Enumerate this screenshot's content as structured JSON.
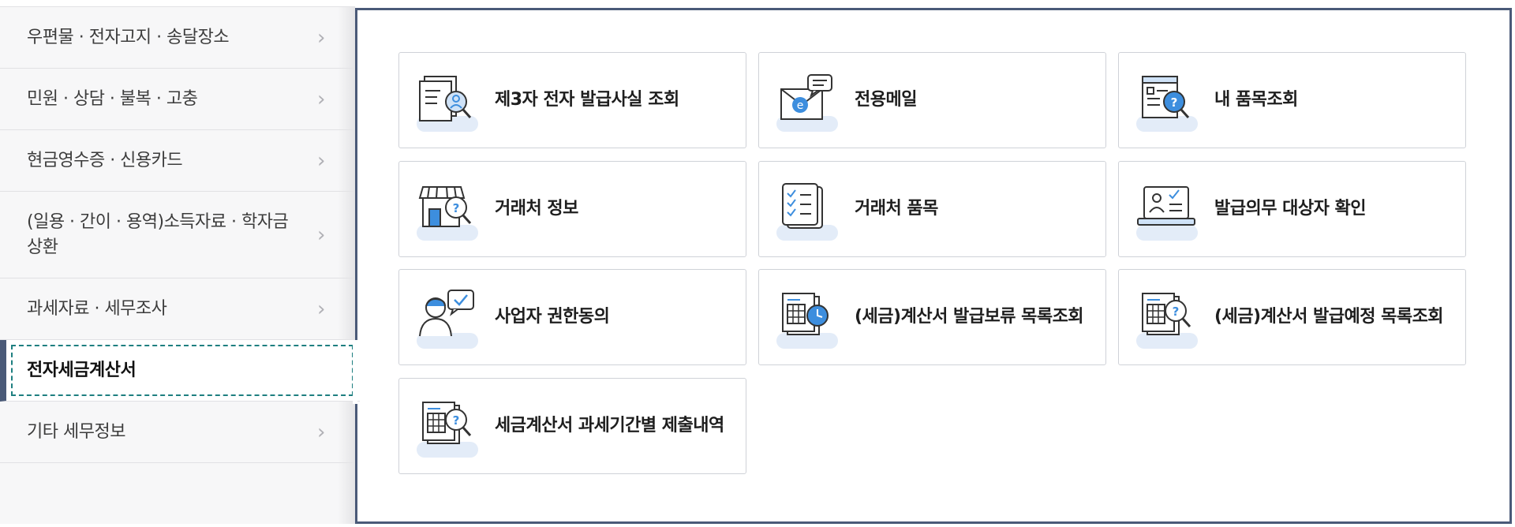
{
  "sidebar": {
    "items": [
      {
        "label": "우편물 · 전자고지 · 송달장소",
        "active": false
      },
      {
        "label": "민원 · 상담 · 불복 · 고충",
        "active": false
      },
      {
        "label": "현금영수증 · 신용카드",
        "active": false
      },
      {
        "label": "(일용 · 간이 · 용역)소득자료 · 학자금상환",
        "active": false
      },
      {
        "label": "과세자료 · 세무조사",
        "active": false
      },
      {
        "label": "전자세금계산서",
        "active": true
      },
      {
        "label": "기타 세무정보",
        "active": false
      }
    ],
    "chevron_icon": "chevron-right-icon"
  },
  "menu": {
    "cards": [
      {
        "label": "제3자 전자 발급사실 조회",
        "icon": "document-search-icon"
      },
      {
        "label": "전용메일",
        "icon": "email-icon"
      },
      {
        "label": "내 품목조회",
        "icon": "item-lookup-icon"
      },
      {
        "label": "거래처 정보",
        "icon": "store-search-icon"
      },
      {
        "label": "거래처 품목",
        "icon": "checklist-icon"
      },
      {
        "label": "발급의무 대상자 확인",
        "icon": "id-card-check-icon"
      },
      {
        "label": "사업자 권한동의",
        "icon": "user-consent-icon"
      },
      {
        "label": "(세금)계산서 발급보류 목록조회",
        "icon": "ledger-clock-icon"
      },
      {
        "label": "(세금)계산서 발급예정 목록조회",
        "icon": "ledger-search-icon"
      },
      {
        "label": "세금계산서 과세기간별 제출내역",
        "icon": "ledger-search-icon"
      }
    ]
  },
  "colors": {
    "accent": "#4a5a78",
    "focus": "#1e7f80",
    "icon_blue": "#3d8ede",
    "icon_light": "#e3ecf8"
  }
}
